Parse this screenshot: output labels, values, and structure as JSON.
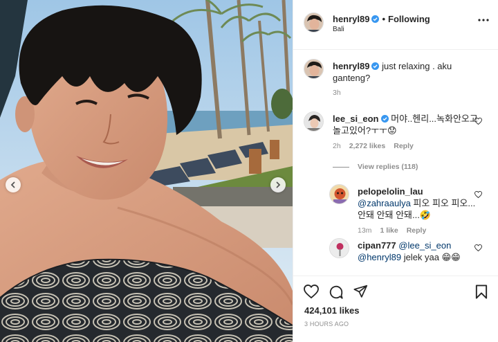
{
  "post": {
    "author": "henryl89",
    "following_label": "Following",
    "separator": "•",
    "location": "Bali"
  },
  "caption": {
    "username": "henryl89",
    "text": "just relaxing . aku ganteng?",
    "time": "3h"
  },
  "comments": [
    {
      "username": "lee_si_eon",
      "text": "머야..헨리...녹화안오고놀고있어?ㅜㅜ😟",
      "time": "2h",
      "likes": "2,272 likes",
      "reply_label": "Reply"
    }
  ],
  "view_replies_label": "View replies (118)",
  "replies": [
    {
      "username": "pelopelolin_lau",
      "mention": "@zahraaulya",
      "text": " 피오 피오 피오...안돼 안돼 안돼...🤣",
      "time": "13m",
      "likes": "1 like",
      "reply_label": "Reply"
    },
    {
      "username": "cipan777",
      "mention": "@lee_si_eon",
      "mention2": "@henryl89",
      "text": " jelek yaa 😁😁",
      "time": "",
      "likes": "",
      "reply_label": ""
    }
  ],
  "footer": {
    "likes": "424,101 likes",
    "time_ago": "3 HOURS AGO"
  },
  "colors": {
    "verified_blue": "#3897f0",
    "mention_blue": "#00376b",
    "muted_gray": "#8e8e8e",
    "divider": "#efefef"
  },
  "icons": {
    "more": "more-horizontal-icon",
    "like": "heart-icon",
    "comment": "comment-bubble-icon",
    "share": "paper-plane-icon",
    "save": "bookmark-icon",
    "prev": "chevron-left-icon",
    "next": "chevron-right-icon",
    "verified": "verified-badge-icon"
  }
}
